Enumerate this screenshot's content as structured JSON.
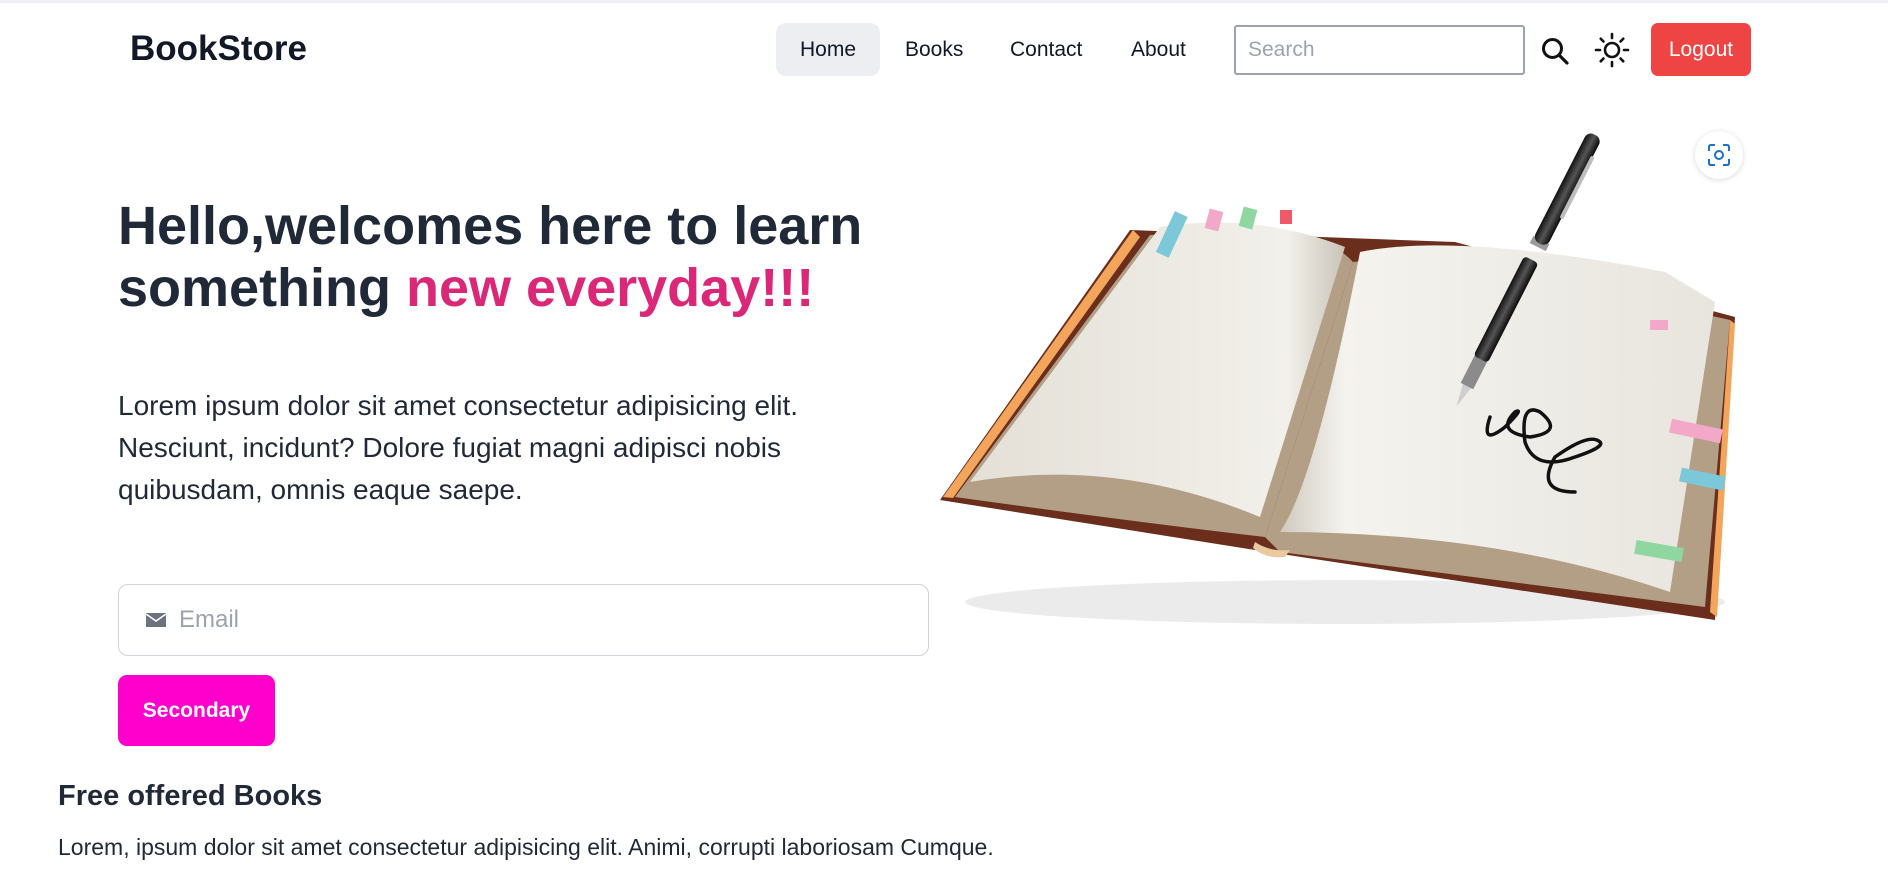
{
  "nav": {
    "brand": "BookStore",
    "items": [
      {
        "label": "Home",
        "active": true
      },
      {
        "label": "Books"
      },
      {
        "label": "Contact"
      },
      {
        "label": "About"
      }
    ],
    "search_placeholder": "Search",
    "search_icon": "search-icon",
    "theme_icon": "sun-icon",
    "logout_label": "Logout"
  },
  "hero": {
    "title_part1": "Hello,welcomes here to learn something ",
    "title_accent": "new everyday!!!",
    "description": "Lorem ipsum dolor sit amet consectetur adipisicing elit. Nesciunt, incidunt? Dolore fugiat magni adipisci nobis quibusdam, omnis eaque saepe.",
    "email_placeholder": "Email",
    "email_icon": "envelope-icon",
    "button_label": "Secondary",
    "image_icon": "open-book-with-pen-illustration",
    "lens_icon": "visual-search-icon"
  },
  "free_section": {
    "title": "Free offered Books",
    "description": "Lorem, ipsum dolor sit amet consectetur adipisicing elit. Animi, corrupti laboriosam Cumque."
  },
  "colors": {
    "accent_pink": "#db2777",
    "secondary_button": "#ff00cc",
    "logout_button": "#ef4444",
    "active_nav_bg": "#eceef1",
    "text_dark": "#1f2937"
  }
}
